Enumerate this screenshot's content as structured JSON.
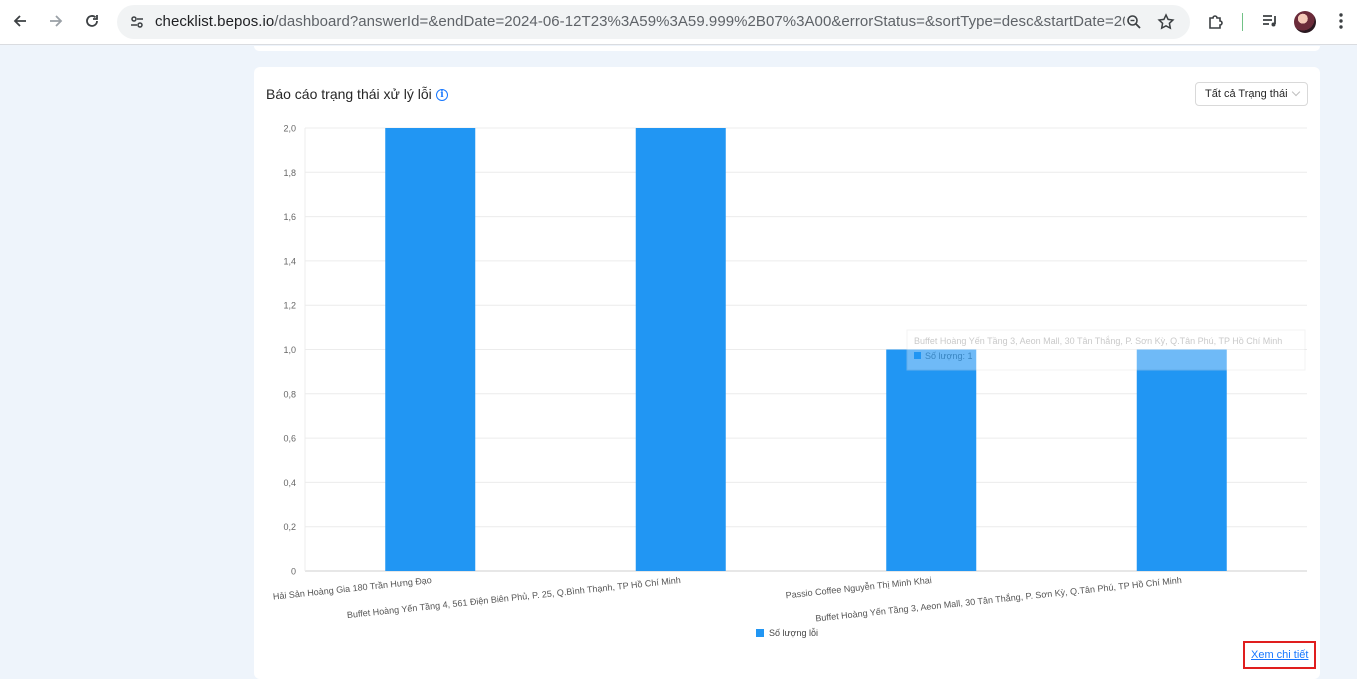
{
  "browser": {
    "url_host": "checklist.bepos.io",
    "url_rest": "/dashboard?answerId=&endDate=2024-06-12T23%3A59%3A59.999%2B07%3A00&errorStatus=&sortType=desc&startDate=2024-06-01..."
  },
  "card": {
    "title": "Báo cáo trạng thái xử lý lỗi",
    "status_select": "Tất cả Trạng thái",
    "view_details": "Xem chi tiết"
  },
  "tooltip": {
    "title": "Buffet Hoàng Yến Tầng 3, Aeon Mall, 30 Tân Thắng, P. Sơn Kỳ, Q.Tân Phú, TP Hồ Chí Minh",
    "row": "Số lượng: 1"
  },
  "chart_data": {
    "type": "bar",
    "categories": [
      "Hải Sản Hoàng Gia 180 Trần Hưng Đạo",
      "Buffet Hoàng Yến Tầng 4, 561 Điện Biên Phủ, P. 25, Q.Bình Thạnh, TP Hồ Chí Minh",
      "Passio Coffee Nguyễn Thị Minh Khai",
      "Buffet Hoàng Yến Tầng 3, Aeon Mall, 30 Tân Thắng, P. Sơn Kỳ, Q.Tân Phú, TP Hồ Chí Minh"
    ],
    "series": [
      {
        "name": "Số lượng lỗi",
        "values": [
          2,
          2,
          1,
          1
        ],
        "color": "#2196f3"
      }
    ],
    "y_ticks": [
      "0",
      "0,2",
      "0,4",
      "0,6",
      "0,8",
      "1,0",
      "1,2",
      "1,4",
      "1,6",
      "1,8",
      "2,0"
    ],
    "ylim": [
      0,
      2
    ],
    "grid": true,
    "legend": "bottom-center"
  }
}
